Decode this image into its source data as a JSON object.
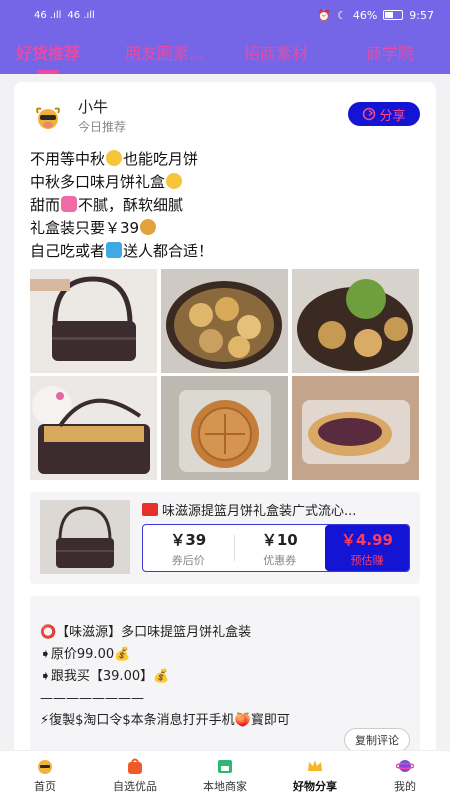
{
  "status_bar": {
    "signal_left": "46 .ıll",
    "signal_right": "46 .ıll",
    "battery": "46%",
    "time": "9:57"
  },
  "tabs": [
    {
      "label": "好货推荐",
      "active": true
    },
    {
      "label": "朋友圈素...",
      "active": false
    },
    {
      "label": "招商素材",
      "active": false
    },
    {
      "label": "商学院",
      "active": false
    }
  ],
  "post": {
    "author": "小牛",
    "subtitle": "今日推荐",
    "share_label": "分享",
    "lines": [
      {
        "before": "不用等中秋",
        "emoji": "grin",
        "after": "也能吃月饼"
      },
      {
        "before": "中秋多口味月饼礼盒",
        "emoji": "kiss",
        "after": ""
      },
      {
        "before": "甜而",
        "emoji": "hearts",
        "after": "不腻，酥软细腻"
      },
      {
        "before": "礼盒装只要￥39",
        "emoji": "moneybag",
        "after": ""
      },
      {
        "before": "自己吃或者",
        "emoji": "gift",
        "after": "送人都合适！"
      }
    ],
    "photos": [
      "basket-on-table",
      "mooncakes-in-tray",
      "green-mooncakes",
      "basket-with-kitty",
      "mooncake-closeup",
      "taro-mooncake"
    ]
  },
  "product": {
    "title": "味滋源提篮月饼礼盒装广式流心...",
    "after_coupon_price": "￥39",
    "after_coupon_label": "券后价",
    "coupon_value": "￥10",
    "coupon_label": "优惠券",
    "estimated_earn": "￥4.99",
    "estimated_earn_label": "预估赚"
  },
  "description": {
    "lines": [
      "⭕【味滋源】多口味提篮月饼礼盒装",
      "➧原价99.00💰",
      "➧跟我买【39.00】💰",
      "————————",
      "⚡復製$淘口令$本条消息打开手机🍑寳即可"
    ],
    "copy_label": "复制评论"
  },
  "bottom_nav": [
    {
      "label": "首页",
      "icon": "home-mascot-icon",
      "active": false
    },
    {
      "label": "自选优品",
      "icon": "shopping-bag-icon",
      "active": false
    },
    {
      "label": "本地商家",
      "icon": "store-icon",
      "active": false
    },
    {
      "label": "好物分享",
      "icon": "crown-icon",
      "active": true
    },
    {
      "label": "我的",
      "icon": "planet-icon",
      "active": false
    }
  ],
  "colors": {
    "header_bg": "#7566e8",
    "tab_text": "#e94aa6",
    "share_bg": "#1414d4",
    "price_highlight": "#ff3b5c"
  }
}
